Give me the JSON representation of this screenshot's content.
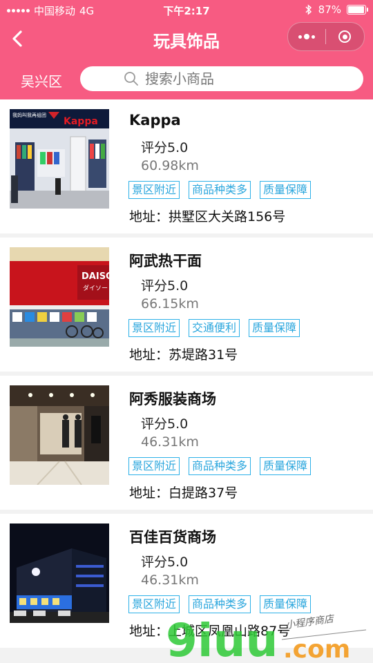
{
  "status_bar": {
    "carrier": "中国移动",
    "network": "4G",
    "time": "下午2:17",
    "battery": "87%",
    "battery_level": 0.87
  },
  "nav": {
    "title": "玩具饰品"
  },
  "search": {
    "district": "吴兴区",
    "placeholder": "搜索小商品"
  },
  "stores": [
    {
      "name": "Kappa",
      "rating": "评分5.0",
      "distance": "60.98km",
      "tags": [
        "景区附近",
        "商品种类多",
        "质量保障"
      ],
      "address": "地址：拱墅区大关路156号",
      "sign_text": "Kappa",
      "sign_subtext": "我妈叫我再组团"
    },
    {
      "name": "阿武热干面",
      "rating": "评分5.0",
      "distance": "66.15km",
      "tags": [
        "景区附近",
        "交通便利",
        "质量保障"
      ],
      "address": "地址：苏堤路31号",
      "sign_text": "DAISO",
      "sign_subtext": "ダイソー"
    },
    {
      "name": "阿秀服装商场",
      "rating": "评分5.0",
      "distance": "46.31km",
      "tags": [
        "景区附近",
        "商品种类多",
        "质量保障"
      ],
      "address": "地址：白提路37号"
    },
    {
      "name": "百佳百货商场",
      "rating": "评分5.0",
      "distance": "46.31km",
      "tags": [
        "景区附近",
        "商品种类多",
        "质量保障"
      ],
      "address": "地址：上城区凤凰山路87号"
    }
  ],
  "watermark": {
    "brand": "9iuu",
    "domain": ".com",
    "slogan": "小程序商店"
  },
  "colors": {
    "theme": "#f75b82",
    "tag_border": "#2bb0e8",
    "watermark_green": "#2ec936",
    "watermark_orange": "#f39a1e"
  }
}
